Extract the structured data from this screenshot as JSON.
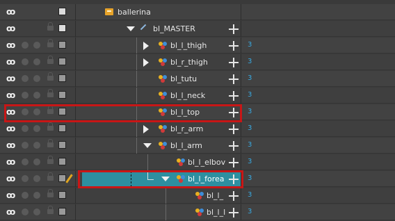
{
  "layers": [
    {
      "name": "ballerina",
      "type": "group",
      "count": ""
    },
    {
      "name": "bl_MASTER",
      "type": "master",
      "count": ""
    },
    {
      "name": "bl_l_thigh",
      "type": "peg",
      "count": "3"
    },
    {
      "name": "bl_r_thigh",
      "type": "peg",
      "count": "3"
    },
    {
      "name": "bl_tutu",
      "type": "peg",
      "count": "3"
    },
    {
      "name": "bl_l_neck",
      "type": "peg",
      "count": "3"
    },
    {
      "name": "bl_l_top",
      "type": "peg",
      "count": "3"
    },
    {
      "name": "bl_r_arm",
      "type": "peg",
      "count": "3"
    },
    {
      "name": "bl_l_arm",
      "type": "peg",
      "count": "3"
    },
    {
      "name": "bl_l_elbov",
      "type": "peg",
      "count": "3"
    },
    {
      "name": "bl_l_forea",
      "type": "peg",
      "count": "3"
    },
    {
      "name": "bl_l_",
      "type": "peg",
      "count": "3"
    },
    {
      "name": "bl_l_l",
      "type": "peg",
      "count": "3"
    }
  ],
  "icons": {
    "visibility": "eye-icon",
    "lock": "lock-icon",
    "expand": "triangle-icon",
    "add": "plus-icon"
  },
  "colors": {
    "selection": "#2d8fa0",
    "highlight": "#c81616",
    "count_text": "#38a8e0"
  }
}
